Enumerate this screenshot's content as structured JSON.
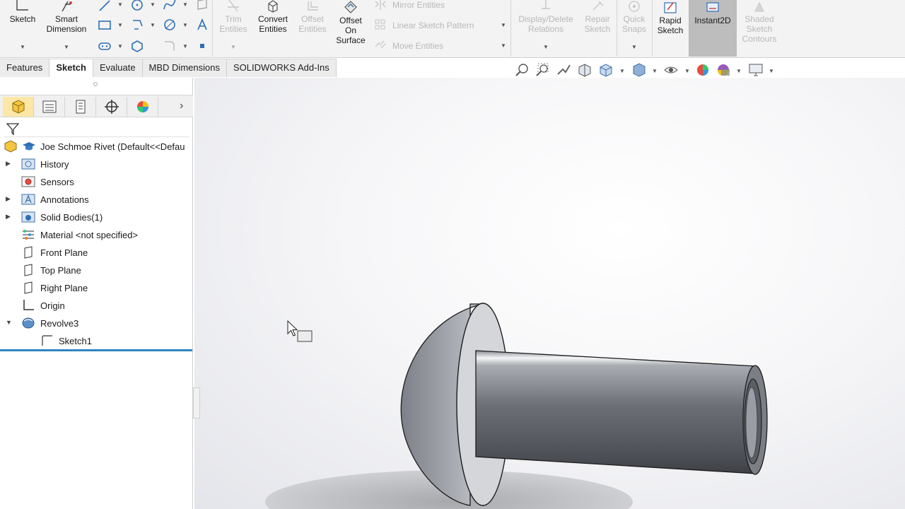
{
  "ribbon": {
    "sketch": "Sketch",
    "smart_dimension_1": "Smart",
    "smart_dimension_2": "Dimension",
    "trim_1": "Trim",
    "trim_2": "Entities",
    "convert_1": "Convert",
    "convert_2": "Entities",
    "offset_1": "Offset",
    "offset_2": "Entities",
    "offset_surface_1": "Offset",
    "offset_surface_2": "On",
    "offset_surface_3": "Surface",
    "mirror": "Mirror Entities",
    "linear_pattern": "Linear Sketch Pattern",
    "move": "Move Entities",
    "display_relations_1": "Display/Delete",
    "display_relations_2": "Relations",
    "repair_1": "Repair",
    "repair_2": "Sketch",
    "quick_snaps_1": "Quick",
    "quick_snaps_2": "Snaps",
    "rapid_1": "Rapid",
    "rapid_2": "Sketch",
    "instant2d": "Instant2D",
    "shaded_1": "Shaded",
    "shaded_2": "Sketch",
    "shaded_3": "Contours"
  },
  "tabs": [
    {
      "label": "Features"
    },
    {
      "label": "Sketch"
    },
    {
      "label": "Evaluate"
    },
    {
      "label": "MBD Dimensions"
    },
    {
      "label": "SOLIDWORKS Add-Ins"
    }
  ],
  "tree": {
    "root": "Joe Schmoe Rivet  (Default<<Defau",
    "items": [
      {
        "label": "History"
      },
      {
        "label": "Sensors"
      },
      {
        "label": "Annotations"
      },
      {
        "label": "Solid Bodies(1)"
      },
      {
        "label": "Material <not specified>"
      },
      {
        "label": "Front Plane"
      },
      {
        "label": "Top Plane"
      },
      {
        "label": "Right Plane"
      },
      {
        "label": "Origin"
      },
      {
        "label": "Revolve3"
      },
      {
        "label": "Sketch1"
      }
    ]
  },
  "colors": {
    "accent": "#2e86c1",
    "model_metal": "#6e7178",
    "active_tool": "#bdbdbd"
  },
  "icons": [
    "sketch-icon",
    "smart-dimension-icon",
    "line-icon",
    "rectangle-icon",
    "slot-icon",
    "circle-icon",
    "spline-icon",
    "text-icon",
    "trim-icon",
    "convert-icon",
    "offset-icon",
    "offset-surface-icon",
    "mirror-icon",
    "pattern-icon",
    "move-icon",
    "relations-icon",
    "repair-icon",
    "quick-snaps-icon",
    "rapid-sketch-icon",
    "instant2d-icon",
    "shaded-contours-icon",
    "zoom-fit-icon",
    "zoom-area-icon",
    "previous-view-icon",
    "section-view-icon",
    "view-orientation-icon",
    "display-style-icon",
    "hide-show-icon",
    "appearance-icon",
    "scene-icon",
    "monitor-icon",
    "filter-icon",
    "cursor-icon"
  ]
}
